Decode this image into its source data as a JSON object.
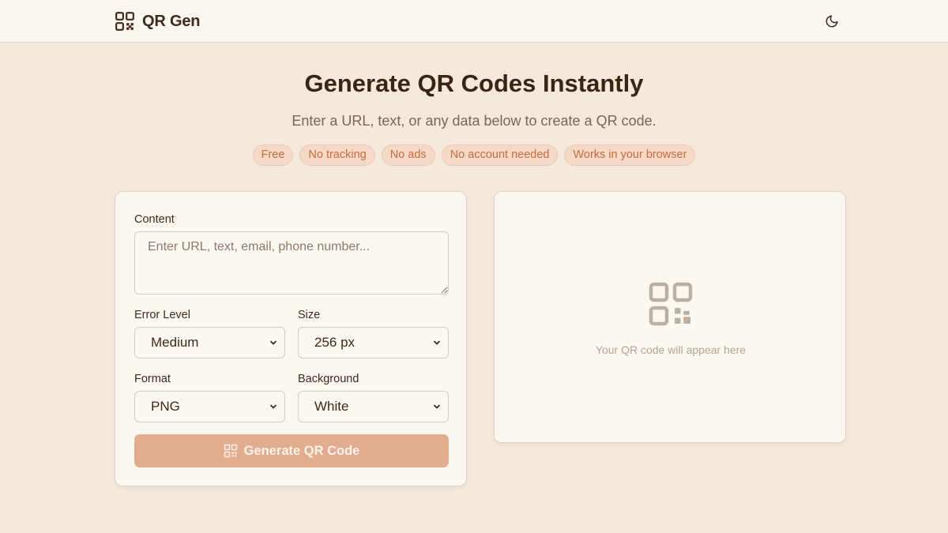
{
  "header": {
    "brand_name": "QR Gen",
    "brand_icon": "qr-code-icon",
    "theme_toggle_icon": "moon-icon"
  },
  "hero": {
    "title": "Generate QR Codes Instantly",
    "subtitle": "Enter a URL, text, or any data below to create a QR code.",
    "pills": [
      "Free",
      "No tracking",
      "No ads",
      "No account needed",
      "Works in your browser"
    ]
  },
  "form": {
    "content_label": "Content",
    "content_value": "",
    "content_placeholder": "Enter URL, text, email, phone number...",
    "error_level_label": "Error Level",
    "error_level_value": "Medium",
    "size_label": "Size",
    "size_value": "256 px",
    "format_label": "Format",
    "format_value": "PNG",
    "background_label": "Background",
    "background_value": "White",
    "generate_label": "Generate QR Code"
  },
  "preview": {
    "placeholder_text": "Your QR code will appear here",
    "icon": "qr-code-icon"
  },
  "colors": {
    "page_bg": "#f5e9dd",
    "card_bg": "#fbf7f1",
    "accent": "#e2ad8f",
    "pill_text": "#c56d3f",
    "pill_bg": "#f3d9c6"
  }
}
